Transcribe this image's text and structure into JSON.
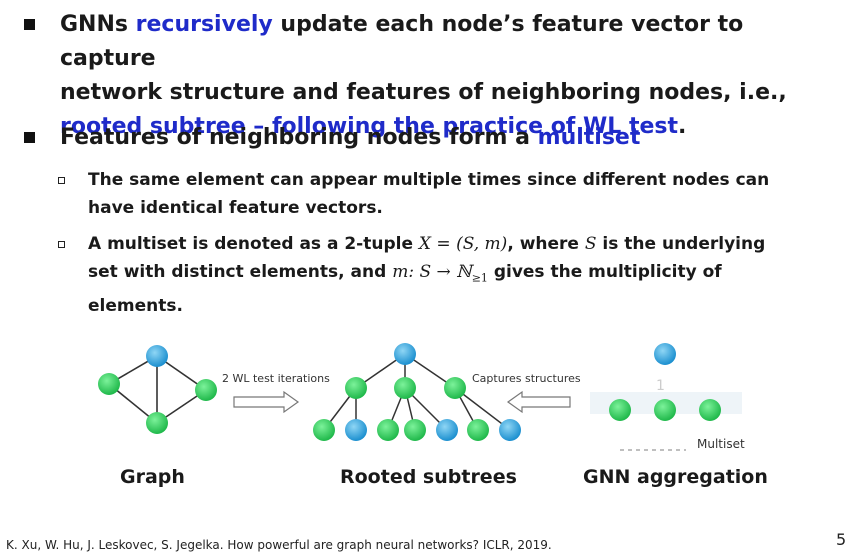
{
  "bullets": {
    "b1": {
      "part1": "GNNs ",
      "hl1": "recursively",
      "part2": " update each node’s feature vector to capture",
      "line2": "network structure and features of neighboring nodes, i.e.,",
      "hl2": "rooted subtree – following the practice of WL test",
      "end": "."
    },
    "b2": {
      "part1": "Features of neighboring nodes form a ",
      "hl1": "multiset"
    },
    "sub1": {
      "line1": "The same element can appear multiple times since different nodes can",
      "line2": "have identical feature vectors."
    },
    "sub2": {
      "pre": "A multiset is denoted as a 2-tuple ",
      "math1": "X = (S, m)",
      "mid": ", where ",
      "math2": "S",
      "post": " is the underlying",
      "line2a": "set with distinct elements, and ",
      "math3": "m",
      "math3b": ": S → ℕ",
      "sub": "≥1",
      "line2b": " gives the multiplicity of",
      "line3": "elements."
    }
  },
  "figure": {
    "arrow1_label": "2 WL test iterations",
    "arrow2_label": "Captures structures",
    "multiset_label": "Multiset",
    "graph_label": "Graph",
    "subtree_label": "Rooted subtrees",
    "gnn_label": "GNN aggregation",
    "colors": {
      "green": "#2dd65a",
      "blue": "#2aa7e0",
      "edge": "#333333"
    }
  },
  "footer": {
    "citation": "K. Xu, W. Hu, J. Leskovec, S. Jegelka. How powerful are graph neural networks? ICLR, 2019.",
    "page": "5"
  }
}
